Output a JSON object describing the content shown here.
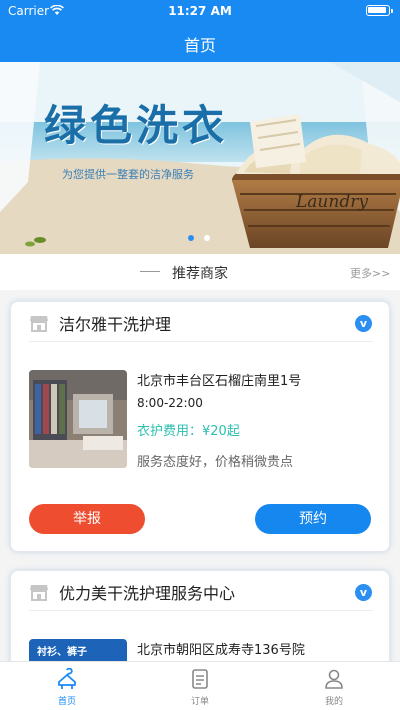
{
  "status_bar": {
    "carrier": "Carrier",
    "time": "11:27 AM"
  },
  "nav": {
    "title": "首页"
  },
  "banner": {
    "headline": "绿色洗衣",
    "subtitle": "为您提供一整套的洁净服务",
    "tag": "Laundry",
    "active_slide": 1,
    "slide_count": 2
  },
  "section": {
    "title": "推荐商家",
    "more": "更多>>"
  },
  "merchants": [
    {
      "name": "洁尔雅干洗护理",
      "address": "北京市丰台区石榴庄南里1号",
      "hours": "8:00-22:00",
      "fee": "衣护费用：¥20起",
      "comment": "服务态度好，价格稍微贵点",
      "report_label": "举报",
      "book_label": "预约",
      "verified_icon": "verified-v-icon"
    },
    {
      "name": "优力美干洗护理服务中心",
      "address": "北京市朝阳区成寿寺136号院",
      "thumb_label": "衬衫、裤子",
      "verified_icon": "verified-v-icon"
    }
  ],
  "tabbar": {
    "items": [
      {
        "label": "首页",
        "icon": "hanger-icon",
        "active": true
      },
      {
        "label": "订单",
        "icon": "order-list-icon",
        "active": false
      },
      {
        "label": "我的",
        "icon": "user-icon",
        "active": false
      }
    ]
  },
  "colors": {
    "primary": "#1a8af3",
    "report_button": "#ee4e2f",
    "book_button": "#1687ee",
    "fee_text": "#2bc0b0"
  }
}
